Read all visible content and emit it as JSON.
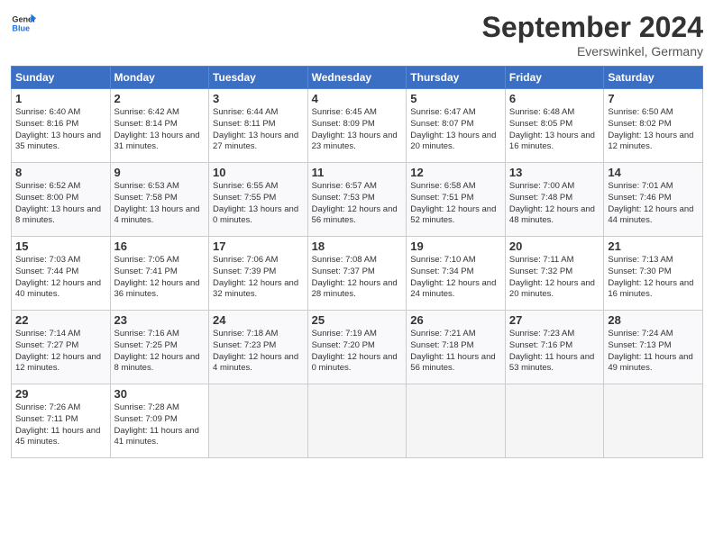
{
  "header": {
    "logo_text_top": "General",
    "logo_text_bottom": "Blue",
    "month": "September 2024",
    "location": "Everswinkel, Germany"
  },
  "days_of_week": [
    "Sunday",
    "Monday",
    "Tuesday",
    "Wednesday",
    "Thursday",
    "Friday",
    "Saturday"
  ],
  "weeks": [
    [
      {
        "day": "1",
        "sunrise": "Sunrise: 6:40 AM",
        "sunset": "Sunset: 8:16 PM",
        "daylight": "Daylight: 13 hours and 35 minutes."
      },
      {
        "day": "2",
        "sunrise": "Sunrise: 6:42 AM",
        "sunset": "Sunset: 8:14 PM",
        "daylight": "Daylight: 13 hours and 31 minutes."
      },
      {
        "day": "3",
        "sunrise": "Sunrise: 6:44 AM",
        "sunset": "Sunset: 8:11 PM",
        "daylight": "Daylight: 13 hours and 27 minutes."
      },
      {
        "day": "4",
        "sunrise": "Sunrise: 6:45 AM",
        "sunset": "Sunset: 8:09 PM",
        "daylight": "Daylight: 13 hours and 23 minutes."
      },
      {
        "day": "5",
        "sunrise": "Sunrise: 6:47 AM",
        "sunset": "Sunset: 8:07 PM",
        "daylight": "Daylight: 13 hours and 20 minutes."
      },
      {
        "day": "6",
        "sunrise": "Sunrise: 6:48 AM",
        "sunset": "Sunset: 8:05 PM",
        "daylight": "Daylight: 13 hours and 16 minutes."
      },
      {
        "day": "7",
        "sunrise": "Sunrise: 6:50 AM",
        "sunset": "Sunset: 8:02 PM",
        "daylight": "Daylight: 13 hours and 12 minutes."
      }
    ],
    [
      {
        "day": "8",
        "sunrise": "Sunrise: 6:52 AM",
        "sunset": "Sunset: 8:00 PM",
        "daylight": "Daylight: 13 hours and 8 minutes."
      },
      {
        "day": "9",
        "sunrise": "Sunrise: 6:53 AM",
        "sunset": "Sunset: 7:58 PM",
        "daylight": "Daylight: 13 hours and 4 minutes."
      },
      {
        "day": "10",
        "sunrise": "Sunrise: 6:55 AM",
        "sunset": "Sunset: 7:55 PM",
        "daylight": "Daylight: 13 hours and 0 minutes."
      },
      {
        "day": "11",
        "sunrise": "Sunrise: 6:57 AM",
        "sunset": "Sunset: 7:53 PM",
        "daylight": "Daylight: 12 hours and 56 minutes."
      },
      {
        "day": "12",
        "sunrise": "Sunrise: 6:58 AM",
        "sunset": "Sunset: 7:51 PM",
        "daylight": "Daylight: 12 hours and 52 minutes."
      },
      {
        "day": "13",
        "sunrise": "Sunrise: 7:00 AM",
        "sunset": "Sunset: 7:48 PM",
        "daylight": "Daylight: 12 hours and 48 minutes."
      },
      {
        "day": "14",
        "sunrise": "Sunrise: 7:01 AM",
        "sunset": "Sunset: 7:46 PM",
        "daylight": "Daylight: 12 hours and 44 minutes."
      }
    ],
    [
      {
        "day": "15",
        "sunrise": "Sunrise: 7:03 AM",
        "sunset": "Sunset: 7:44 PM",
        "daylight": "Daylight: 12 hours and 40 minutes."
      },
      {
        "day": "16",
        "sunrise": "Sunrise: 7:05 AM",
        "sunset": "Sunset: 7:41 PM",
        "daylight": "Daylight: 12 hours and 36 minutes."
      },
      {
        "day": "17",
        "sunrise": "Sunrise: 7:06 AM",
        "sunset": "Sunset: 7:39 PM",
        "daylight": "Daylight: 12 hours and 32 minutes."
      },
      {
        "day": "18",
        "sunrise": "Sunrise: 7:08 AM",
        "sunset": "Sunset: 7:37 PM",
        "daylight": "Daylight: 12 hours and 28 minutes."
      },
      {
        "day": "19",
        "sunrise": "Sunrise: 7:10 AM",
        "sunset": "Sunset: 7:34 PM",
        "daylight": "Daylight: 12 hours and 24 minutes."
      },
      {
        "day": "20",
        "sunrise": "Sunrise: 7:11 AM",
        "sunset": "Sunset: 7:32 PM",
        "daylight": "Daylight: 12 hours and 20 minutes."
      },
      {
        "day": "21",
        "sunrise": "Sunrise: 7:13 AM",
        "sunset": "Sunset: 7:30 PM",
        "daylight": "Daylight: 12 hours and 16 minutes."
      }
    ],
    [
      {
        "day": "22",
        "sunrise": "Sunrise: 7:14 AM",
        "sunset": "Sunset: 7:27 PM",
        "daylight": "Daylight: 12 hours and 12 minutes."
      },
      {
        "day": "23",
        "sunrise": "Sunrise: 7:16 AM",
        "sunset": "Sunset: 7:25 PM",
        "daylight": "Daylight: 12 hours and 8 minutes."
      },
      {
        "day": "24",
        "sunrise": "Sunrise: 7:18 AM",
        "sunset": "Sunset: 7:23 PM",
        "daylight": "Daylight: 12 hours and 4 minutes."
      },
      {
        "day": "25",
        "sunrise": "Sunrise: 7:19 AM",
        "sunset": "Sunset: 7:20 PM",
        "daylight": "Daylight: 12 hours and 0 minutes."
      },
      {
        "day": "26",
        "sunrise": "Sunrise: 7:21 AM",
        "sunset": "Sunset: 7:18 PM",
        "daylight": "Daylight: 11 hours and 56 minutes."
      },
      {
        "day": "27",
        "sunrise": "Sunrise: 7:23 AM",
        "sunset": "Sunset: 7:16 PM",
        "daylight": "Daylight: 11 hours and 53 minutes."
      },
      {
        "day": "28",
        "sunrise": "Sunrise: 7:24 AM",
        "sunset": "Sunset: 7:13 PM",
        "daylight": "Daylight: 11 hours and 49 minutes."
      }
    ],
    [
      {
        "day": "29",
        "sunrise": "Sunrise: 7:26 AM",
        "sunset": "Sunset: 7:11 PM",
        "daylight": "Daylight: 11 hours and 45 minutes."
      },
      {
        "day": "30",
        "sunrise": "Sunrise: 7:28 AM",
        "sunset": "Sunset: 7:09 PM",
        "daylight": "Daylight: 11 hours and 41 minutes."
      },
      null,
      null,
      null,
      null,
      null
    ]
  ]
}
